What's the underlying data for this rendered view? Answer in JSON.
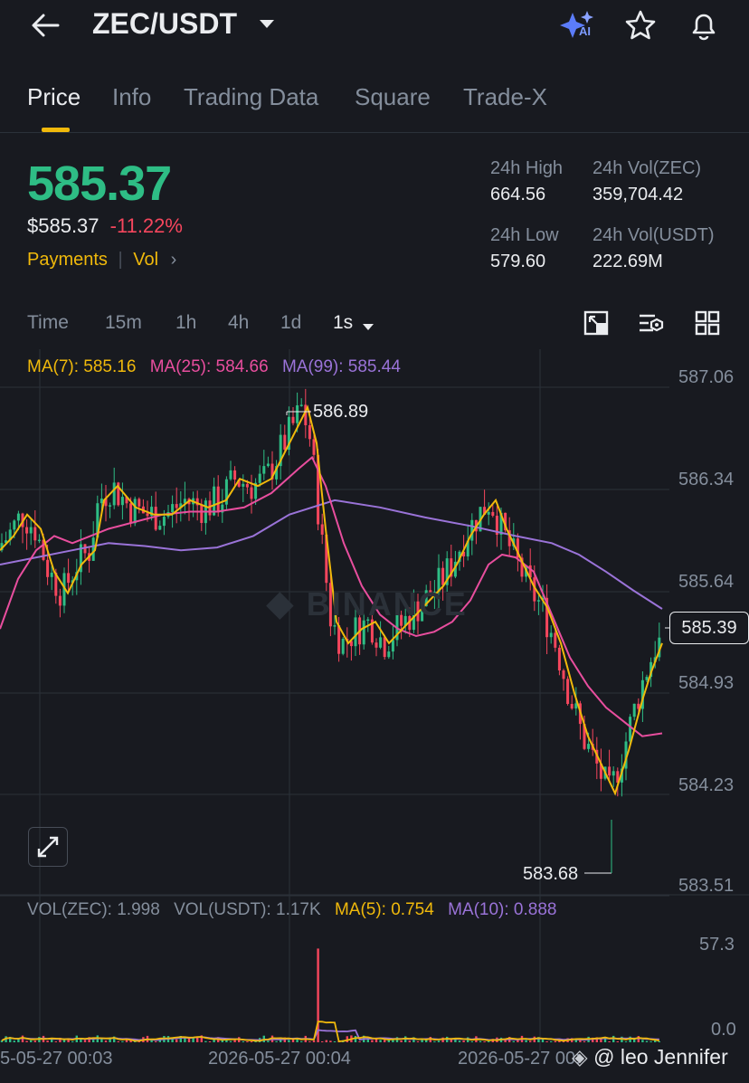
{
  "header": {
    "pair": "ZEC/USDT",
    "ai_badge": "AI",
    "icons": [
      "back-arrow-icon",
      "dropdown-caret-icon",
      "ai-sparkle-icon",
      "star-icon",
      "bell-icon"
    ]
  },
  "tabs": [
    "Price",
    "Info",
    "Trading Data",
    "Square",
    "Trade-X"
  ],
  "active_tab": "Price",
  "ticker": {
    "last_price": "585.37",
    "usd_price": "$585.37",
    "change_pct": "-11.22%",
    "tag_payments": "Payments",
    "tag_vol": "Vol",
    "stats": {
      "high_label": "24h High",
      "high_value": "664.56",
      "vol_zec_label": "24h Vol(ZEC)",
      "vol_zec_value": "359,704.42",
      "low_label": "24h Low",
      "low_value": "579.60",
      "vol_usdt_label": "24h Vol(USDT)",
      "vol_usdt_value": "222.69M"
    }
  },
  "intervals": [
    "Time",
    "15m",
    "1h",
    "4h",
    "1d",
    "1s"
  ],
  "selected_interval": "1s",
  "ma_legend": {
    "ma7": "MA(7): 585.16",
    "ma25": "MA(25): 584.66",
    "ma99": "MA(99): 585.44"
  },
  "price_axis": [
    "587.06",
    "586.34",
    "585.64",
    "584.93",
    "584.23",
    "583.51"
  ],
  "markers": {
    "high": "586.89",
    "low": "583.68",
    "current": "585.39"
  },
  "watermark": "BINANCE",
  "volume_legend": {
    "vol_zec": "VOL(ZEC): 1.998",
    "vol_usdt": "VOL(USDT): 1.17K",
    "ma5": "MA(5): 0.754",
    "ma10": "MA(10): 0.888"
  },
  "volume_axis": [
    "57.3",
    "0.0"
  ],
  "time_axis": [
    "5-05-27 00:03",
    "2026-05-27 00:04",
    "2026-05-27 00:"
  ],
  "credit": "@ leo Jennifer",
  "colors": {
    "up": "#2ebd85",
    "down": "#f6465d",
    "accent": "#f0b90b",
    "ma7": "#f0b90b",
    "ma25": "#e84e9e",
    "ma99": "#9a73d8"
  },
  "chart_data": {
    "type": "candlestick",
    "interval": "1s",
    "ylim": [
      583.51,
      587.06
    ],
    "ma7_path": [
      [
        0,
        585.85
      ],
      [
        15,
        585.95
      ],
      [
        30,
        586.1
      ],
      [
        45,
        586.0
      ],
      [
        60,
        585.7
      ],
      [
        75,
        585.55
      ],
      [
        90,
        585.75
      ],
      [
        105,
        585.85
      ],
      [
        115,
        586.2
      ],
      [
        130,
        586.3
      ],
      [
        150,
        586.15
      ],
      [
        170,
        586.1
      ],
      [
        190,
        586.1
      ],
      [
        210,
        586.2
      ],
      [
        230,
        586.15
      ],
      [
        250,
        586.2
      ],
      [
        265,
        586.35
      ],
      [
        285,
        586.3
      ],
      [
        300,
        586.35
      ],
      [
        320,
        586.6
      ],
      [
        340,
        586.85
      ],
      [
        350,
        586.6
      ],
      [
        360,
        586.0
      ],
      [
        372,
        585.35
      ],
      [
        385,
        585.2
      ],
      [
        400,
        585.3
      ],
      [
        415,
        585.35
      ],
      [
        430,
        585.2
      ],
      [
        445,
        585.3
      ],
      [
        460,
        585.4
      ],
      [
        475,
        585.5
      ],
      [
        490,
        585.6
      ],
      [
        505,
        585.75
      ],
      [
        520,
        585.95
      ],
      [
        535,
        586.1
      ],
      [
        548,
        586.2
      ],
      [
        560,
        586.0
      ],
      [
        575,
        585.8
      ],
      [
        590,
        585.6
      ],
      [
        605,
        585.45
      ],
      [
        620,
        585.2
      ],
      [
        635,
        584.85
      ],
      [
        650,
        584.55
      ],
      [
        665,
        584.35
      ],
      [
        680,
        584.15
      ],
      [
        695,
        584.45
      ],
      [
        710,
        584.8
      ],
      [
        720,
        585.0
      ],
      [
        732,
        585.2
      ]
    ],
    "ma25_path": [
      [
        0,
        585.3
      ],
      [
        20,
        585.65
      ],
      [
        40,
        585.85
      ],
      [
        60,
        585.95
      ],
      [
        80,
        585.9
      ],
      [
        100,
        585.95
      ],
      [
        120,
        586.0
      ],
      [
        150,
        586.05
      ],
      [
        180,
        586.1
      ],
      [
        210,
        586.12
      ],
      [
        240,
        586.12
      ],
      [
        270,
        586.15
      ],
      [
        300,
        586.25
      ],
      [
        330,
        586.42
      ],
      [
        345,
        586.5
      ],
      [
        360,
        586.3
      ],
      [
        380,
        585.9
      ],
      [
        400,
        585.6
      ],
      [
        420,
        585.4
      ],
      [
        440,
        585.3
      ],
      [
        460,
        585.25
      ],
      [
        480,
        585.28
      ],
      [
        500,
        585.35
      ],
      [
        520,
        585.5
      ],
      [
        540,
        585.75
      ],
      [
        555,
        585.82
      ],
      [
        570,
        585.8
      ],
      [
        590,
        585.7
      ],
      [
        610,
        585.4
      ],
      [
        630,
        585.1
      ],
      [
        650,
        584.9
      ],
      [
        670,
        584.75
      ],
      [
        690,
        584.65
      ],
      [
        710,
        584.55
      ],
      [
        732,
        584.57
      ]
    ],
    "ma99_path": [
      [
        0,
        585.75
      ],
      [
        40,
        585.8
      ],
      [
        80,
        585.85
      ],
      [
        120,
        585.9
      ],
      [
        160,
        585.88
      ],
      [
        200,
        585.85
      ],
      [
        240,
        585.87
      ],
      [
        280,
        585.95
      ],
      [
        320,
        586.1
      ],
      [
        370,
        586.2
      ],
      [
        420,
        586.15
      ],
      [
        470,
        586.08
      ],
      [
        520,
        586.02
      ],
      [
        570,
        585.95
      ],
      [
        610,
        585.9
      ],
      [
        640,
        585.82
      ],
      [
        670,
        585.7
      ],
      [
        700,
        585.57
      ],
      [
        732,
        585.44
      ]
    ],
    "volume_ylim": [
      0,
      57.3
    ]
  }
}
